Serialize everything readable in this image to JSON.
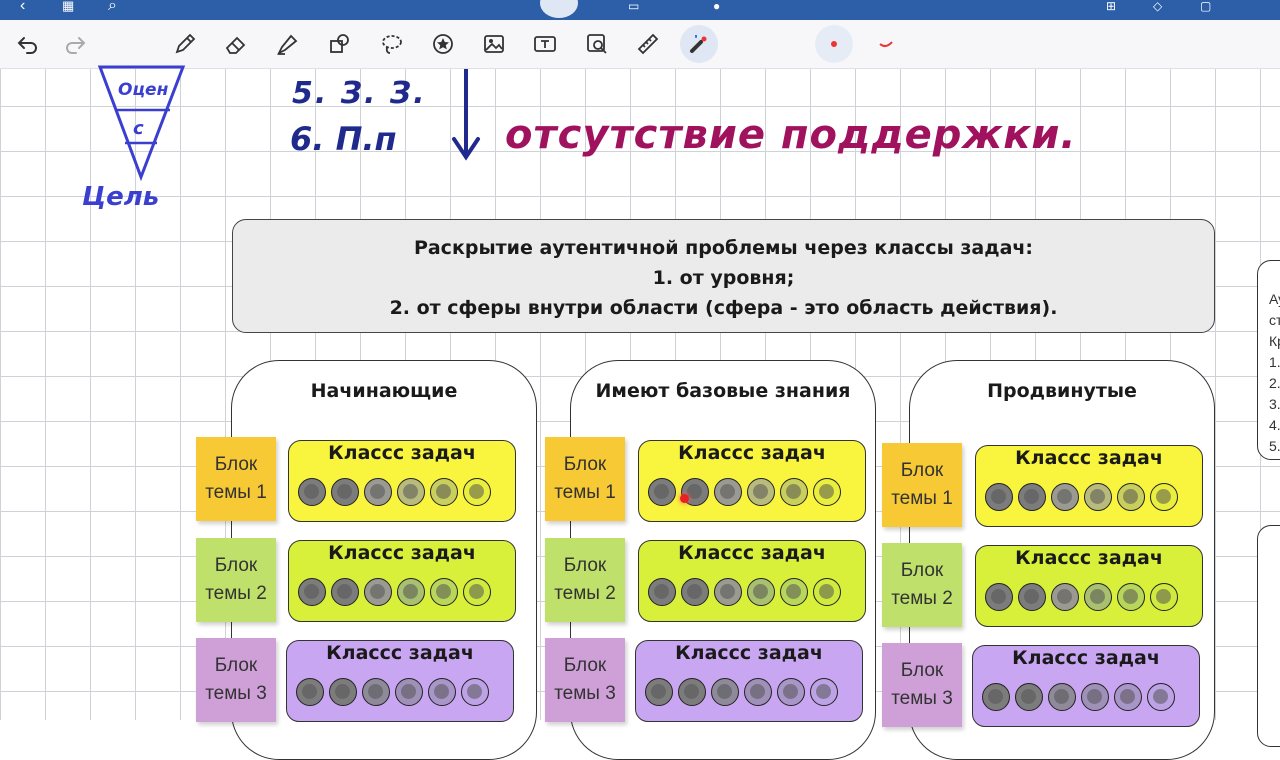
{
  "toolbar": {
    "icons": [
      "undo-icon",
      "redo-icon",
      "pen-icon",
      "eraser-icon",
      "highlighter-icon",
      "shapes-icon",
      "lasso-icon",
      "sticker-icon",
      "image-icon",
      "text-box-icon",
      "zoom-image-icon",
      "ruler-icon",
      "laser-pointer-icon"
    ]
  },
  "handwriting": {
    "triangle_top": "Оцен",
    "triangle_bottom": "с",
    "goal": "Цель",
    "line5": "5. З. З.",
    "line6": "6. П.п",
    "no_support": "отсутствие поддержки."
  },
  "header": {
    "line1": "Раскрытие аутентичной проблемы через классы задач:",
    "line2": "1. от уровня;",
    "line3": "2. от сферы внутри области (сфера - это область действия)."
  },
  "columns": [
    {
      "title": "Начинающие",
      "rows": [
        {
          "sticky": "Блок темы 1",
          "class_label": "Классс задач"
        },
        {
          "sticky": "Блок темы 2",
          "class_label": "Классс задач"
        },
        {
          "sticky": "Блок темы 3",
          "class_label": "Классс задач"
        }
      ]
    },
    {
      "title": "Имеют базовые знания",
      "rows": [
        {
          "sticky": "Блок темы 1",
          "class_label": "Классс задач"
        },
        {
          "sticky": "Блок темы 2",
          "class_label": "Классс задач"
        },
        {
          "sticky": "Блок темы 3",
          "class_label": "Классс задач"
        }
      ]
    },
    {
      "title": "Продвинутые",
      "rows": [
        {
          "sticky": "Блок темы 1",
          "class_label": "Классс задач"
        },
        {
          "sticky": "Блок темы 2",
          "class_label": "Классс задач"
        },
        {
          "sticky": "Блок темы 3",
          "class_label": "Классс задач"
        }
      ]
    }
  ],
  "right_panel": {
    "lines": [
      "Ау",
      "ст",
      "Кр",
      "1.",
      "2.",
      "3.",
      "4.",
      "5."
    ]
  },
  "colors": {
    "topbar": "#2d5fa8",
    "ink_blue": "#1f2a8c",
    "ink_magenta": "#a0125e",
    "ink_violet": "#3b3fd0",
    "class_yellow": "#f9f53e",
    "class_lime": "#d8f03a",
    "class_purple": "#c9a6f2",
    "sticky_orange": "#f6c935",
    "sticky_lime": "#bfe06a",
    "sticky_purple": "#cfa0d8",
    "header_bg": "#ebebeb"
  }
}
